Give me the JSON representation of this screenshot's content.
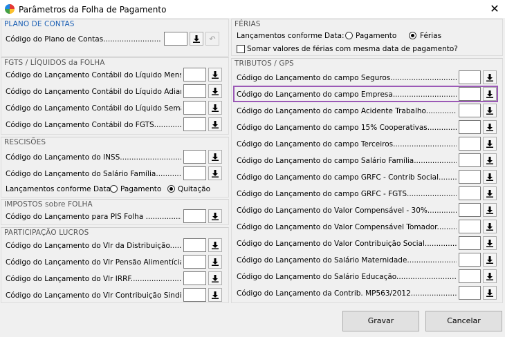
{
  "window": {
    "title": "Parâmetros da Folha de Pagamento",
    "close_glyph": "✕"
  },
  "plano": {
    "title": "PLANO DE CONTAS",
    "label": "Código do Plano de Contas.........................",
    "value": ""
  },
  "fgts": {
    "title": "FGTS / LÍQUIDOS da FOLHA",
    "rows": [
      {
        "label": "Código do Lançamento Contábil do Líquido Mensal...."
      },
      {
        "label": "Código do Lançamento Contábil do Líquido Adianto...."
      },
      {
        "label": "Código do Lançamento Contábil do Líquido Semanal...."
      },
      {
        "label": "Código do Lançamento Contábil do FGTS..................."
      }
    ]
  },
  "rescisoes": {
    "title": "RESCISÕES",
    "rows": [
      {
        "label": "Código do Lançamento do INSS..............................."
      },
      {
        "label": "Código do Lançamento do Salário Família..................."
      }
    ],
    "data_label": "Lançamentos conforme Data:",
    "options": [
      "Pagamento",
      "Quitação"
    ],
    "selected": "Quitação"
  },
  "impostos": {
    "title": "IMPOSTOS sobre FOLHA",
    "rows": [
      {
        "label": "Código do Lançamento para PIS Folha ......................"
      }
    ]
  },
  "participacao": {
    "title": "PARTICIPAÇÃO  LUCROS",
    "rows": [
      {
        "label": "Código do Lançamento do Vlr da Distribuição..............."
      },
      {
        "label": "Código do Lançamento do Vlr Pensão Alimentícia........"
      },
      {
        "label": "Código do Lançamento do Vlr IRRF............................."
      },
      {
        "label": "Código do Lançamento do Vlr Contribuição Sindical......"
      }
    ]
  },
  "ferias": {
    "title": "FÉRIAS",
    "data_label": "Lançamentos conforme Data:",
    "options": [
      "Pagamento",
      "Férias"
    ],
    "selected": "Férias",
    "sum_label": "Somar valores de férias com mesma data de pagamento?",
    "sum_checked": false
  },
  "tributos": {
    "title": "TRIBUTOS  /  GPS",
    "rows": [
      {
        "label": "Código do Lançamento do campo Seguros...................................."
      },
      {
        "label": "Código do Lançamento do campo Empresa....................................."
      },
      {
        "label": "Código do Lançamento do campo Acidente Trabalho............................."
      },
      {
        "label": "Código do Lançamento do campo 15% Cooperativas.............................."
      },
      {
        "label": "Código do Lançamento do campo Terceiros....................................."
      },
      {
        "label": "Código do Lançamento do campo Salário Família.............................."
      },
      {
        "label": "Código do Lançamento do campo GRFC - Contrib Social........................."
      },
      {
        "label": "Código do Lançamento do campo GRFC - FGTS...................................."
      },
      {
        "label": "Código do Lançamento do Valor Compensável - 30%............................."
      },
      {
        "label": "Código do Lançamento do Valor Compensável Tomador.........................."
      },
      {
        "label": "Código do Lançamento do Valor Contribuição Social.........................."
      },
      {
        "label": "Código do Lançamento do Salário Maternidade................................"
      },
      {
        "label": "Código do Lançamento do Salário Educação...................................."
      },
      {
        "label": "Código do Lançamento da Contrib. MP563/2012................................"
      }
    ],
    "highlighted_row": 1
  },
  "buttons": {
    "save": "Gravar",
    "cancel": "Cancelar"
  },
  "colors": {
    "highlight": "#9b59b6",
    "group_title_blue": "#1a5fb4"
  }
}
